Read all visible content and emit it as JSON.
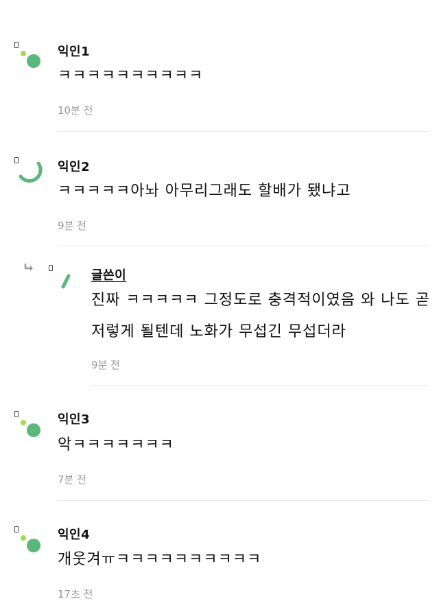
{
  "comments": [
    {
      "author": "익인1",
      "text": "ㅋㅋㅋㅋㅋㅋㅋㅋㅋㅋ",
      "time": "10분 전",
      "avatar_icon": "dots-avatar-icon"
    },
    {
      "author": "익인2",
      "text": "ㅋㅋㅋㅋㅋ아놔 아무리그래도 할배가 됐냐고",
      "time": "9분 전",
      "avatar_icon": "arc-avatar-icon"
    },
    {
      "author": "글쓴이",
      "is_reply": true,
      "text_line1": "진짜 ㅋㅋㅋㅋㅋ 그정도로 충격적이였음 와 나도 곧",
      "text_line2": "저렇게 될텐데 노화가 무섭긴 무섭더라",
      "time": "9분 전",
      "avatar_icon": "slash-avatar-icon"
    },
    {
      "author": "익인3",
      "text": "악ㅋㅋㅋㅋㅋㅋㅋ",
      "time": "7분 전",
      "avatar_icon": "dots-avatar-icon"
    },
    {
      "author": "익인4",
      "text": "개웃겨ㅠㅋㅋㅋㅋㅋㅋㅋㅋㅋㅋ",
      "time": "17초 전",
      "avatar_icon": "dots-avatar-icon"
    }
  ],
  "colors": {
    "avatar_green": "#5cb87a",
    "avatar_lime": "#a7d94f",
    "time_gray": "#9a9a9a",
    "divider": "#e8e8e8"
  }
}
